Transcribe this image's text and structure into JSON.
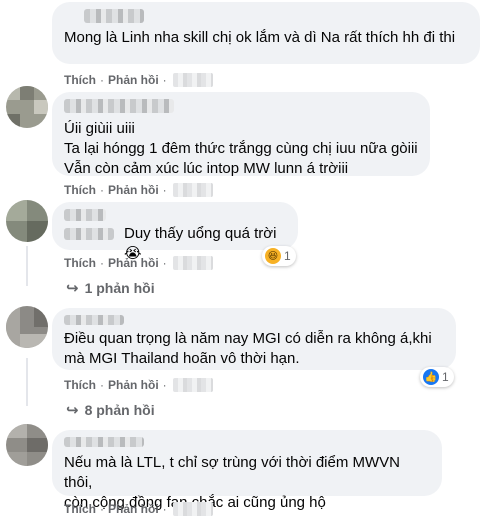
{
  "comments": [
    {
      "text": "Mong là Linh nha skill chị ok lắm và dì Na rất thích hh đi thi",
      "actions": {
        "like": "Thích",
        "reply": "Phản hồi"
      }
    },
    {
      "text": "Úii giùii uiii\nTa lại hóngg 1 đêm thức trắngg cùng chị iuu nữa gòiii\nVẫn còn cảm xúc lúc intop MW lunn á trờiii",
      "actions": {
        "like": "Thích",
        "reply": "Phản hồi"
      }
    },
    {
      "text": "Duy thấy uổng quá trời 😭",
      "actions": {
        "like": "Thích",
        "reply": "Phản hồi"
      },
      "reaction": {
        "icon": "haha-icon",
        "count": "1",
        "color": "#f7b125"
      },
      "replies_label": "1 phản hồi"
    },
    {
      "text": "Điều quan trọng là năm nay MGI có diễn ra không á,khi mà MGI Thailand hoãn vô thời hạn.",
      "actions": {
        "like": "Thích",
        "reply": "Phản hồi"
      },
      "reaction": {
        "icon": "like-icon",
        "count": "1",
        "color": "#1877f2"
      },
      "replies_label": "8 phản hồi"
    },
    {
      "text": "Nếu mà là LTL, t chỉ sợ trùng với thời điểm MWVN thôi,\ncòn cộng đồng fan chắc ai cũng ủng hộ",
      "actions": {
        "like": "Thích",
        "reply": "Phản hồi"
      }
    }
  ]
}
